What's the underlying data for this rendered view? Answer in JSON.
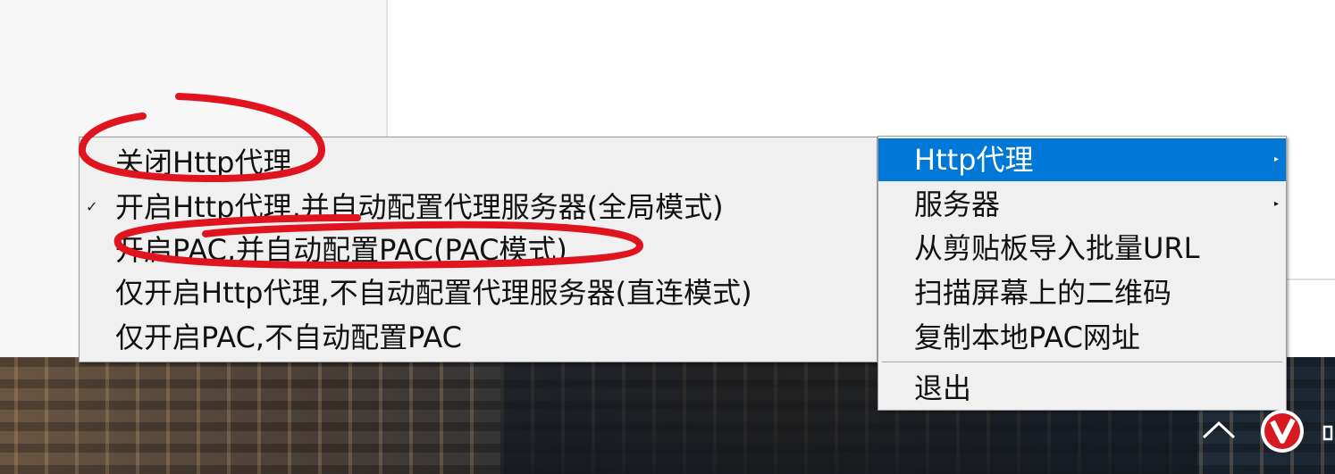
{
  "submenu": {
    "items": [
      {
        "label": "关闭Http代理",
        "checked": false
      },
      {
        "label": "开启Http代理,并自动配置代理服务器(全局模式)",
        "checked": true
      },
      {
        "label": "开启PAC,并自动配置PAC(PAC模式)",
        "checked": false
      },
      {
        "label": "仅开启Http代理,不自动配置代理服务器(直连模式)",
        "checked": false
      },
      {
        "label": "仅开启PAC,不自动配置PAC",
        "checked": false
      }
    ]
  },
  "main_menu": {
    "items": [
      {
        "label": "Http代理",
        "has_submenu": true,
        "highlighted": true
      },
      {
        "label": "服务器",
        "has_submenu": true
      },
      {
        "label": "从剪贴板导入批量URL"
      },
      {
        "label": "扫描屏幕上的二维码"
      },
      {
        "label": "复制本地PAC网址"
      },
      {
        "label": "退出"
      }
    ]
  },
  "glyphs": {
    "check": "✓",
    "submenu_arrow": "▸"
  },
  "colors": {
    "highlight": "#0078d7",
    "annotation": "#e0141e",
    "menu_bg": "#f0f0f0"
  },
  "tray": {
    "icons": [
      "chevron-up-icon",
      "v2ray-icon",
      "speaker-icon"
    ]
  }
}
